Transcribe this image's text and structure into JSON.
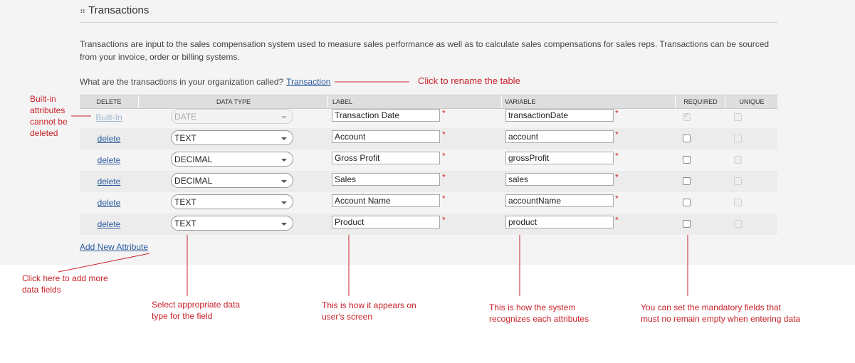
{
  "section": {
    "title": "Transactions"
  },
  "description": "Transactions are input to the sales compensation system used to measure sales performance as well as to calculate sales compensations for sales reps. Transactions can be sourced from your invoice, order or billing systems.",
  "question": {
    "text": "What are the transactions in your organization called?",
    "link": "Transaction"
  },
  "table": {
    "headers": {
      "delete": "DELETE",
      "data_type": "DATA TYPE",
      "label": "LABEL",
      "variable": "VARIABLE",
      "required": "REQUIRED",
      "unique": "UNIQUE"
    },
    "rows": [
      {
        "action": "Built-In",
        "type": "DATE",
        "label": "Transaction Date",
        "variable": "transactionDate",
        "required": true
      },
      {
        "action": "delete",
        "type": "TEXT",
        "label": "Account",
        "variable": "account",
        "required": false
      },
      {
        "action": "delete",
        "type": "DECIMAL",
        "label": "Gross Profit",
        "variable": "grossProfit",
        "required": false
      },
      {
        "action": "delete",
        "type": "DECIMAL",
        "label": "Sales",
        "variable": "sales",
        "required": false
      },
      {
        "action": "delete",
        "type": "TEXT",
        "label": "Account Name",
        "variable": "accountName",
        "required": false
      },
      {
        "action": "delete",
        "type": "TEXT",
        "label": "Product",
        "variable": "product",
        "required": false
      }
    ],
    "required_marker": "*"
  },
  "add_new": "Add New Attribute",
  "annotations": {
    "rename": "Click to rename the table",
    "builtin": [
      "Built-in",
      "attributes",
      "cannot be",
      "deleted"
    ],
    "add_more": [
      "Click here to add more",
      "data fields"
    ],
    "data_type": [
      "Select appropriate data",
      "type for the field"
    ],
    "label": [
      "This is how it appears on",
      "user's screen"
    ],
    "variable": [
      "This is how the system",
      "recognizes each attributes"
    ],
    "required": [
      "You can set the mandatory fields that",
      "must no remain empty when entering data"
    ]
  },
  "colors": {
    "annotation": "#c8222a",
    "link": "#2a5aa0"
  }
}
